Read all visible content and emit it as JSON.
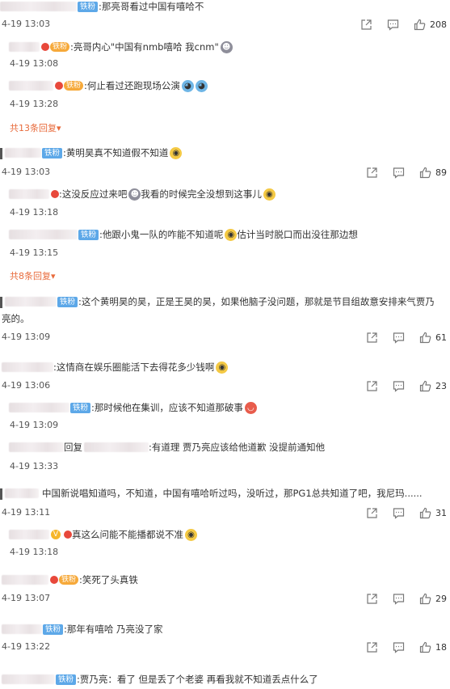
{
  "badge_label": "铁粉",
  "vip_label": "铁粉",
  "show_replies_arrow": "▾",
  "comments": [
    {
      "text": ":那亮哥看过中国有嘻哈不",
      "time": "4-19 13:03",
      "likes": "208"
    },
    {
      "text": ":亮哥内心\"中国有nmb嘻哈 我cnm\"",
      "time": "4-19 13:08"
    },
    {
      "text": ":何止看过还跑现场公演",
      "time": "4-19 13:28"
    },
    {
      "more": "共13条回复"
    },
    {
      "text": ":黄明昊真不知道假不知道",
      "time": "4-19 13:03",
      "likes": "89"
    },
    {
      "text": ":这没反应过来吧",
      "text2": "我看的时候完全没想到这事儿",
      "time": "4-19 13:18"
    },
    {
      "text": ":他跟小鬼一队的咋能不知道呢",
      "text2": "估计当时脱口而出没往那边想",
      "time": "4-19 13:15"
    },
    {
      "more": "共8条回复"
    },
    {
      "text": ":这个黄明昊的昊，正是王昊的昊，如果他脑子没问题，那就是节目组故意安排来气贾乃",
      "text_cont": "亮的。",
      "time": "4-19 13:09",
      "likes": "61"
    },
    {
      "text": ":这情商在娱乐圈能活下去得花多少钱啊",
      "time": "4-19 13:06",
      "likes": "23"
    },
    {
      "text": ":那时候他在集训，应该不知道那破事",
      "time": "4-19 13:09"
    },
    {
      "text_reply_prefix": "回复",
      "text": ":有道理 贾乃亮应该给他道歉 没提前通知他",
      "time": "4-19 13:33"
    },
    {
      "text": "中国新说唱知道吗，不知道，中国有嘻哈听过吗，没听过，那PG1总共知道了吧，我尼玛......",
      "time": "4-19 13:11",
      "likes": "31"
    },
    {
      "text": "真这么问能不能播都说不准",
      "time": "4-19 13:18"
    },
    {
      "text": ":笑死了头真铁",
      "time": "4-19 13:07",
      "likes": "29"
    },
    {
      "text": ":那年有嘻哈 乃亮没了家",
      "time": "4-19 13:22",
      "likes": "18"
    },
    {
      "text": ":贾乃亮：看了 但是丢了个老婆 再看我就不知道丢点什么了"
    }
  ],
  "icons": {
    "share": "share-icon",
    "comment": "comment-icon",
    "like": "like-icon"
  }
}
